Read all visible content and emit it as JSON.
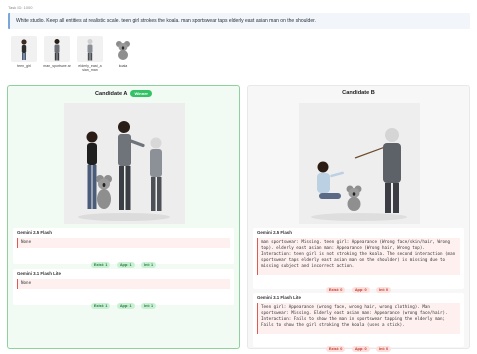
{
  "task": {
    "id_label": "Task ID: 1000"
  },
  "prompt": "White studio. Keep all entities at realistic scale. teen girl strokes the koala. man sportswear taps elderly east asian man on the shoulder.",
  "references": [
    {
      "caption": "teen_girl",
      "icon": "person-icon"
    },
    {
      "caption": "man_sportswe ar",
      "icon": "person-icon"
    },
    {
      "caption": "elderly_east_a sian_man",
      "icon": "person-icon"
    },
    {
      "caption": "koala",
      "icon": "koala-icon"
    }
  ],
  "candidate_a": {
    "title": "Candidate A",
    "badge": "Winner",
    "models": [
      {
        "name": "Gemini 2.5 Flash",
        "feedback": "None",
        "scores": [
          "Exist: 1",
          "App: 1",
          "Int: 1"
        ]
      },
      {
        "name": "Gemini 3.1 Flash Lite",
        "feedback": "None",
        "scores": [
          "Exist: 1",
          "App: 1",
          "Int: 1"
        ]
      }
    ]
  },
  "candidate_b": {
    "title": "Candidate B",
    "models": [
      {
        "name": "Gemini 2.5 Flash",
        "feedback": "man sportswear: Missing. teen girl: Appearance (Wrong face/skin/hair, Wrong top). elderly east asian man: Appearance (Wrong hair, Wrong top). Interaction: teen girl is not stroking the koala. The second interaction (man sportswear taps elderly east asian man on the shoulder) is missing due to missing subject and incorrect action.",
        "scores": [
          "Exist: 0",
          "App: 0",
          "Int: 0"
        ]
      },
      {
        "name": "Gemini 3.1 Flash Lite",
        "feedback": "Teen girl: Appearance (wrong face, wrong hair, wrong clothing). Man sportswear: Missing. Elderly east asian man: Appearance (wrong face/hair). Interaction: Fails to show the man in sportswear tapping the elderly man; Fails to show the girl stroking the koala (uses a stick).",
        "scores": [
          "Exist: 0",
          "App: 0",
          "Int: 0"
        ]
      }
    ]
  },
  "colors": {
    "winner": "#34c266",
    "ok_pill": "#c9f0d3",
    "bad_pill": "#fde0de",
    "accent_blue": "#7aa6d9"
  }
}
